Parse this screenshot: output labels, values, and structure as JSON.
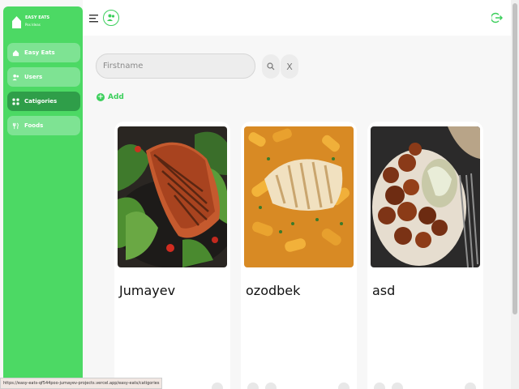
{
  "brand": {
    "name": "EASY EATS",
    "sub": "Pos Ideas"
  },
  "sidebar": {
    "items": [
      {
        "label": "Easy Eats",
        "icon": "home-icon"
      },
      {
        "label": "Users",
        "icon": "users-icon"
      },
      {
        "label": "Catigories",
        "icon": "grid-icon",
        "active": true
      },
      {
        "label": "Foods",
        "icon": "food-icon"
      }
    ]
  },
  "search": {
    "placeholder": "Firstname",
    "value": "",
    "clear_label": "X"
  },
  "add_label": "Add",
  "cards": [
    {
      "title": "Jumayev"
    },
    {
      "title": "ozodbek"
    },
    {
      "title": "asd"
    }
  ],
  "status_url": "https://easy-eats-qf544poo-jumayev-projects.vercel.app/easy-eats/catigories",
  "colors": {
    "accent": "#4cd964",
    "active": "#2f9e49"
  }
}
